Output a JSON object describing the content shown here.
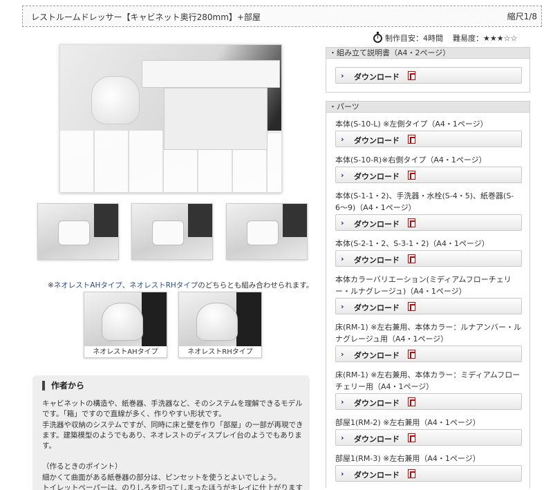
{
  "header": {
    "title": "レストルームドレッサー【キャビネット奥行280mm】+部屋",
    "scale": "縮尺1/8"
  },
  "meta": {
    "time_label": "制作目安：4時間",
    "difficulty_label": "難易度：★★★☆☆"
  },
  "gallery": {
    "note_prefix": "※",
    "note_link_a": "ネオレストAHタイプ",
    "note_sep": "、",
    "note_link_b": "ネオレストRHタイプ",
    "note_suffix": "のどちらとも組み合わせられます。",
    "variant_a_caption": "ネオレストAHタイプ",
    "variant_b_caption": "ネオレストRHタイプ"
  },
  "author": {
    "heading": "作者から",
    "lines": [
      "キャビネットの構造や、紙巻器、手洗器など、そのシステムを理解できるモデル",
      "です。「箱」ですので直線が多く、作りやすい形状です。",
      "手洗器や収納のシステムですが、同時に床と壁を作り「部屋」の一部が再現でき",
      "ます。建築模型のようでもあり、ネオレストのディスプレイ台のようでもありま",
      "す。",
      "",
      "（作るときのポイント）",
      "細かくて曲面がある紙巻器の部分は、ピンセットを使うとよいでしょう。",
      "トイレットペーパーは、のりしろを切ってしまったほうがキレイに仕上がります"
    ]
  },
  "download_label": "ダウンロード",
  "assembly": {
    "heading": "・組み立て説明書（A4・2ページ）"
  },
  "parts": {
    "heading": "・パーツ",
    "items": [
      {
        "label": "本体(S-10-L) ※左側タイプ（A4・1ページ）"
      },
      {
        "label": "本体(S-10-R)※右側タイプ（A4・1ページ）"
      },
      {
        "label": "本体(S-1-1・2)、手洗器・水栓(S-4・5)、紙巻器(S-6〜9)（A4・1ページ）"
      },
      {
        "label": "本体(S-2-1・2、S-3-1・2)（A4・1ページ）"
      },
      {
        "label": "本体カラーバリエーション(ミディアムフローチェリー・ルナグレージュ)（A4・1ページ）"
      },
      {
        "label": "床(RM-1) ※左右兼用、本体カラー：ルナアンバー・ルナグレージュ用（A4・1ページ）"
      },
      {
        "label": "床(RM-1) ※左右兼用、本体カラー：ミディアムフローチェリー用（A4・1ページ）"
      },
      {
        "label": "部屋1(RM-2) ※左右兼用（A4・1ページ）"
      },
      {
        "label": "部屋1(RM-3) ※左右兼用（A4・1ページ）"
      }
    ]
  }
}
